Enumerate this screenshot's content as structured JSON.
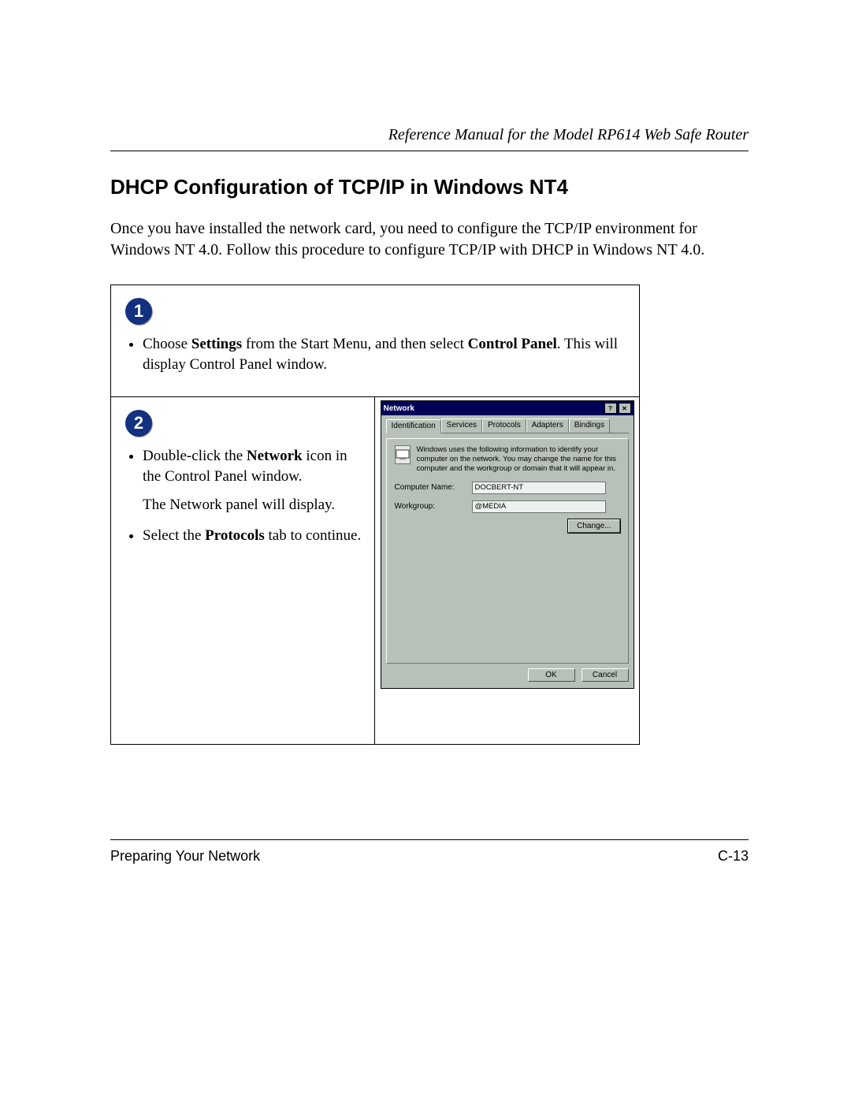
{
  "header": {
    "running_title": "Reference Manual for the Model RP614 Web Safe Router"
  },
  "section": {
    "title": "DHCP Configuration of TCP/IP in Windows NT4",
    "intro": "Once you have installed the network card, you need to configure the TCP/IP environment for Windows NT 4.0. Follow this procedure to configure TCP/IP with DHCP in Windows NT 4.0."
  },
  "steps": {
    "s1": {
      "num": "1",
      "b1_pre": "Choose ",
      "b1_bold1": "Settings",
      "b1_mid": " from the Start Menu, and then select ",
      "b1_bold2": "Control Panel",
      "b1_post": ". This will display Control Panel window."
    },
    "s2": {
      "num": "2",
      "b1_pre": "Double-click the ",
      "b1_bold": "Network",
      "b1_post": " icon in the Control Panel window.",
      "line2": "The Network panel will display.",
      "b3_pre": "Select the ",
      "b3_bold": "Protocols",
      "b3_post": " tab to continue."
    }
  },
  "dialog": {
    "title": "Network",
    "help": "?",
    "close": "✕",
    "tabs": {
      "identification": "Identification",
      "services": "Services",
      "protocols": "Protocols",
      "adapters": "Adapters",
      "bindings": "Bindings"
    },
    "desc": "Windows uses the following information to identify your computer on the network. You may change the name for this computer and the workgroup or domain that it will appear in.",
    "computer_label": "Computer Name:",
    "computer_value": "DOCBERT-NT",
    "workgroup_label": "Workgroup:",
    "workgroup_value": "@MEDIA",
    "change": "Change...",
    "ok": "OK",
    "cancel": "Cancel"
  },
  "footer": {
    "left": "Preparing Your Network",
    "right": "C-13"
  }
}
